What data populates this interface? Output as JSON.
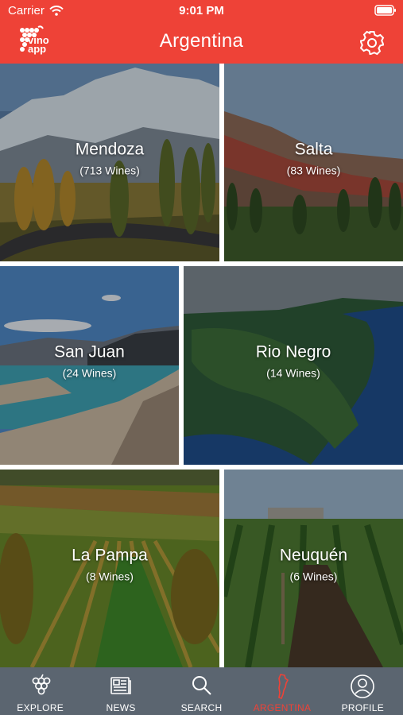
{
  "status_bar": {
    "carrier": "Carrier",
    "time": "9:01 PM"
  },
  "header": {
    "title": "Argentina",
    "logo_text_1": "vino",
    "logo_text_2": "app"
  },
  "regions": [
    {
      "name": "Mendoza",
      "count": "(713 Wines)"
    },
    {
      "name": "Salta",
      "count": "(83 Wines)"
    },
    {
      "name": "San Juan",
      "count": "(24 Wines)"
    },
    {
      "name": "Rio Negro",
      "count": "(14 Wines)"
    },
    {
      "name": "La Pampa",
      "count": "(8 Wines)"
    },
    {
      "name": "Neuquén",
      "count": "(6 Wines)"
    }
  ],
  "tabs": [
    {
      "label": "EXPLORE",
      "icon": "grapes-icon"
    },
    {
      "label": "NEWS",
      "icon": "newspaper-icon"
    },
    {
      "label": "SEARCH",
      "icon": "search-icon"
    },
    {
      "label": "ARGENTINA",
      "icon": "argentina-map-icon",
      "active": true
    },
    {
      "label": "PROFILE",
      "icon": "profile-icon"
    }
  ],
  "colors": {
    "brand": "#ee4237",
    "tab_bar": "#5b6570",
    "active_tab": "#ee4237"
  }
}
